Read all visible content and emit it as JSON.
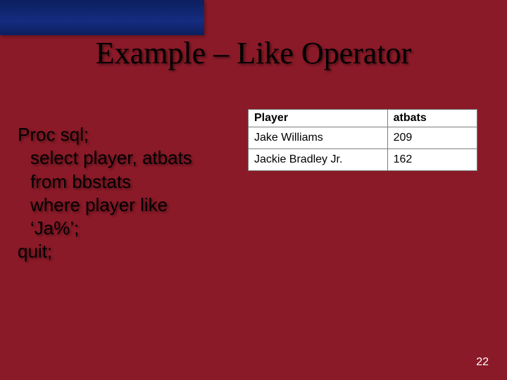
{
  "slide": {
    "title": "Example – Like Operator",
    "page_number": "22"
  },
  "code": {
    "line1": "Proc sql;",
    "line2": "select player, atbats",
    "line3": "from bbstats",
    "line4": "where player like",
    "line5": "‘Ja%’;",
    "line6": "quit;"
  },
  "table": {
    "headers": {
      "player": "Player",
      "atbats": "atbats"
    },
    "rows": [
      {
        "player": "Jake Williams",
        "atbats": "209"
      },
      {
        "player": "Jackie Bradley Jr.",
        "atbats": "162"
      }
    ]
  }
}
